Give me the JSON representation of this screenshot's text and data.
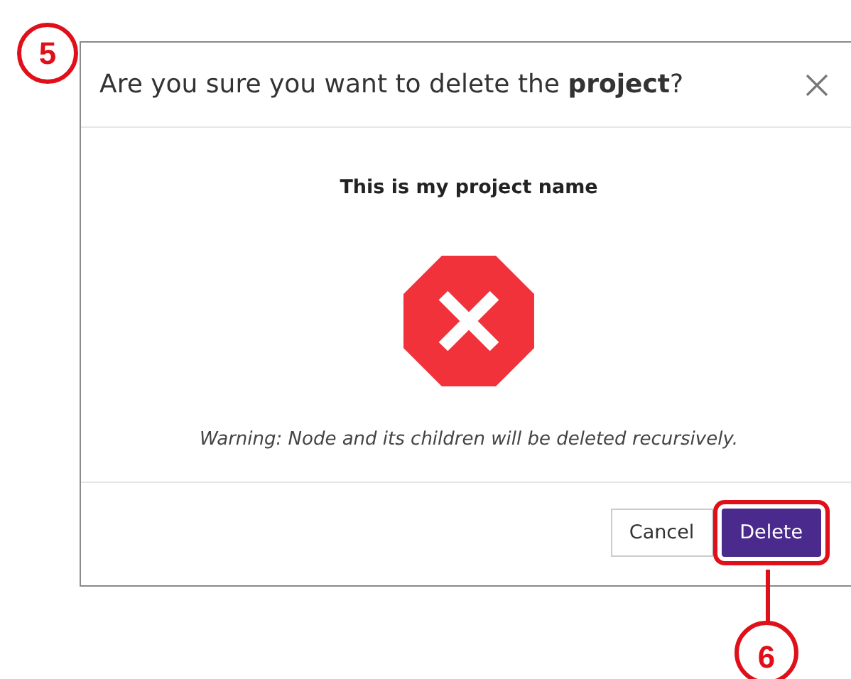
{
  "dialog": {
    "title": "Are you sure you want to delete the **project**?",
    "project_name": "This is my project name",
    "warning": "Warning: Node and its children will be deleted recursively.",
    "buttons": [
      {
        "label": "Cancel",
        "kind": "secondary",
        "highlighted": false
      },
      {
        "label": "Delete",
        "kind": "primary",
        "highlighted": true
      }
    ]
  },
  "annotations": [
    {
      "label": "5"
    },
    {
      "label": "6"
    }
  ]
}
